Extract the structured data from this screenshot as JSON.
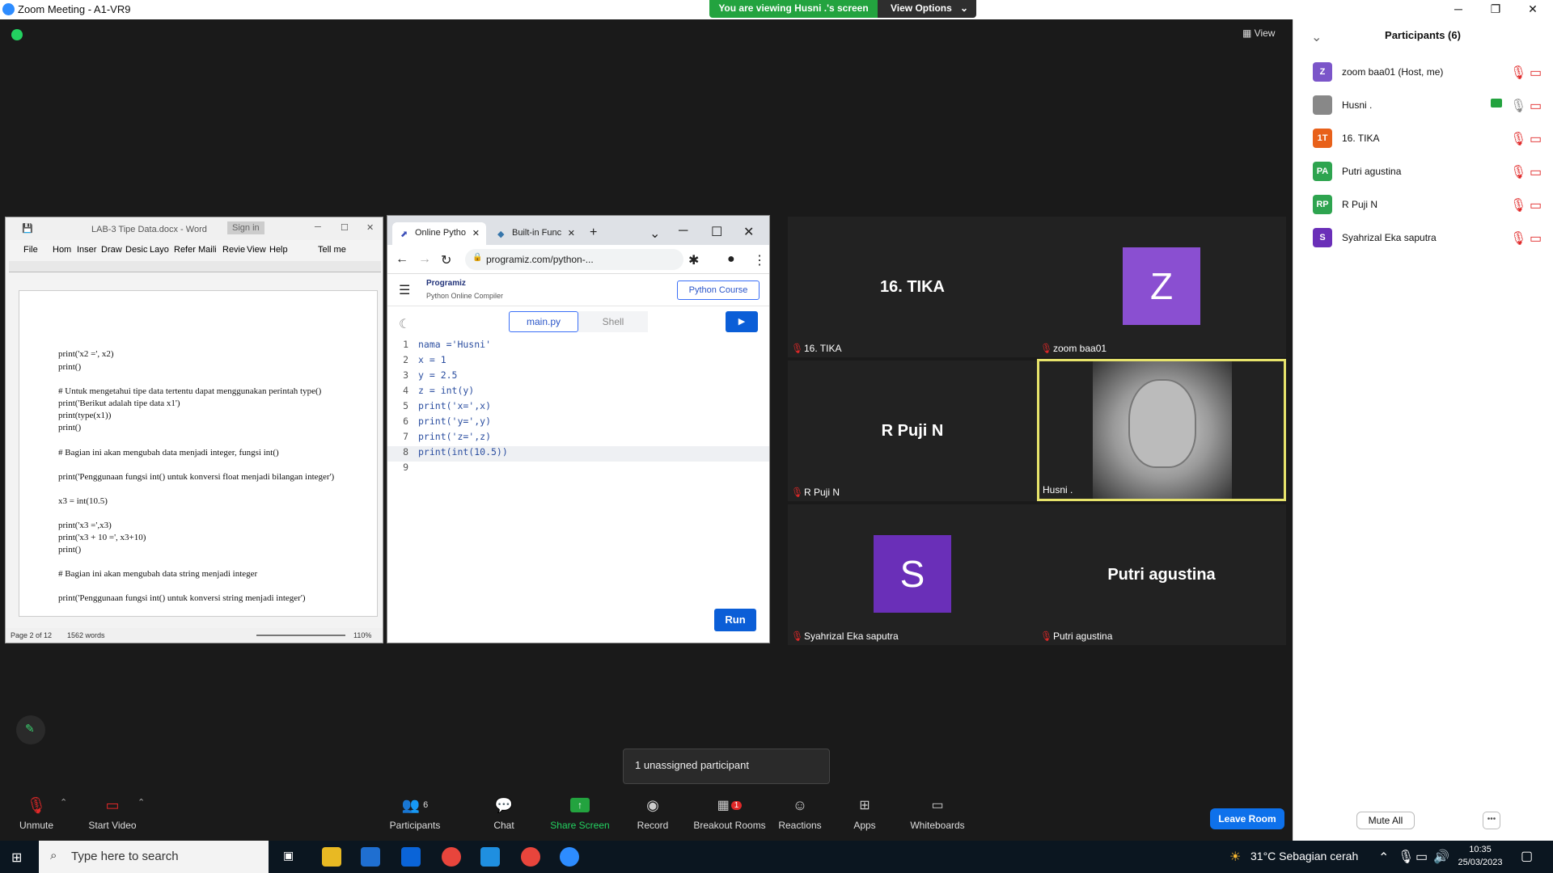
{
  "window": {
    "title": "Zoom Meeting - A1-VR9"
  },
  "banner": {
    "viewing": "You are viewing Husni .'s screen",
    "view_options": "View Options"
  },
  "top_right": {
    "view": "View"
  },
  "word": {
    "title": "LAB-3 Tipe Data.docx - Word",
    "signin": "Sign in",
    "menu": [
      "File",
      "Hom",
      "Inser",
      "Draw",
      "Desic",
      "Layo",
      "Refer",
      "Maili",
      "Revie",
      "View",
      "Help",
      "Tell me"
    ],
    "lines": [
      "print('x2 =', x2)",
      "print()",
      "# Untuk mengetahui tipe data tertentu dapat menggunakan perintah type()",
      "print('Berikut adalah tipe data x1')",
      "print(type(x1))",
      "print()",
      "# Bagian ini akan mengubah data menjadi integer, fungsi int()",
      "print('Penggunaan fungsi int() untuk konversi  float menjadi bilangan integer')",
      "x3 = int(10.5)",
      "print('x3 =',x3)",
      "print('x3 + 10 =', x3+10)",
      "print()",
      "# Bagian ini akan mengubah data string menjadi integer",
      "print('Penggunaan fungsi int() untuk konversi string menjadi integer')"
    ],
    "status_page": "Page 2 of 12",
    "status_words": "1562 words",
    "zoom": "110%"
  },
  "chrome": {
    "tabs": [
      "Online Pytho",
      "Built-in Func"
    ],
    "url": "programiz.com/python-...",
    "brand": "Programiz",
    "brand_sub": "Python Online Compiler",
    "course_btn": "Python Course",
    "file_tab": "main.py",
    "shell_tab": "Shell",
    "run": "Run",
    "code": [
      "nama ='Husni'",
      "x = 1",
      "y = 2.5",
      "z = int(y)",
      "print('x=',x)",
      "print('y=',y)",
      "print('z=',z)",
      "print(int(10.5))",
      ""
    ]
  },
  "tiles": [
    {
      "center": "16. TIKA",
      "label": "16. TIKA"
    },
    {
      "avatar": "Z",
      "label": "zoom baa01",
      "color": "#8a4fd1"
    },
    {
      "center": "R Puji N",
      "label": "R Puji N"
    },
    {
      "label": "Husni ."
    },
    {
      "avatar": "S",
      "label": "Syahrizal Eka saputra",
      "color": "#6a2fb8"
    },
    {
      "center": "Putri agustina",
      "label": "Putri agustina"
    }
  ],
  "participants": {
    "header": "Participants (6)",
    "list": [
      {
        "initials": "Z",
        "name": "zoom baa01 (Host, me)",
        "color": "#7b55c9"
      },
      {
        "initials": "",
        "name": "Husni .",
        "color": "#888888"
      },
      {
        "initials": "1T",
        "name": "16. TIKA",
        "color": "#e8611a"
      },
      {
        "initials": "PA",
        "name": "Putri agustina",
        "color": "#2ea44f"
      },
      {
        "initials": "RP",
        "name": "R Puji N",
        "color": "#2ea44f"
      },
      {
        "initials": "S",
        "name": "Syahrizal Eka saputra",
        "color": "#6a2fb8"
      }
    ],
    "mute_all": "Mute All"
  },
  "toast": "1 unassigned participant",
  "toolbar": {
    "unmute": "Unmute",
    "start_video": "Start Video",
    "participants": "Participants",
    "participants_count": "6",
    "chat": "Chat",
    "share": "Share Screen",
    "record": "Record",
    "breakout": "Breakout Rooms",
    "breakout_badge": "1",
    "reactions": "Reactions",
    "apps": "Apps",
    "whiteboards": "Whiteboards",
    "leave": "Leave Room"
  },
  "taskbar": {
    "search": "Type here to search",
    "weather": "31°C  Sebagian cerah",
    "time": "10:35",
    "date": "25/03/2023"
  }
}
